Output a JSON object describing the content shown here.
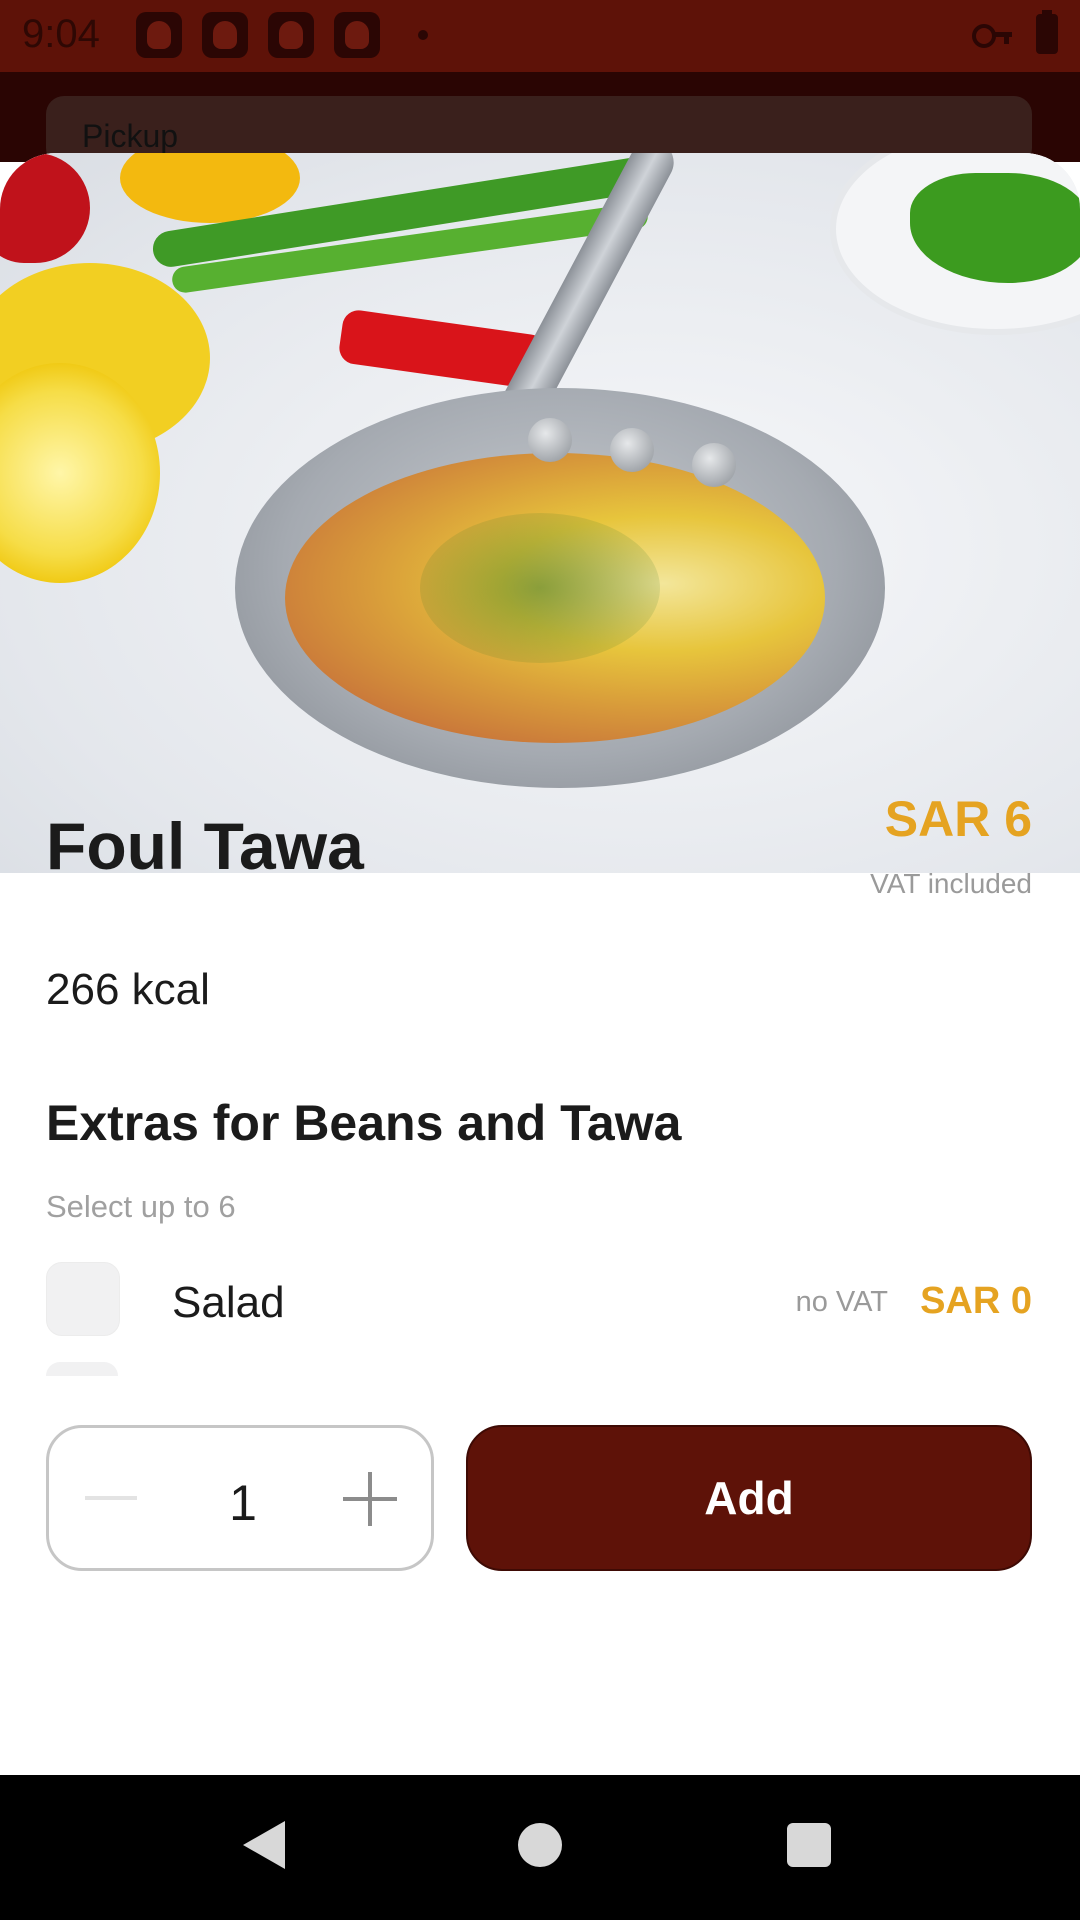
{
  "status_bar": {
    "time": "9:04",
    "app_icons": [
      "app-icon",
      "app-icon",
      "app-icon",
      "app-icon"
    ],
    "icons": [
      "vpn-key-icon",
      "battery-charging-icon"
    ]
  },
  "background": {
    "order_type": "Pickup"
  },
  "item": {
    "title": "Foul Tawa",
    "price": "SAR 6",
    "vat_note": "VAT included",
    "calories": "266 kcal"
  },
  "extras": {
    "title": "Extras for Beans and Tawa",
    "hint": "Select up to 6",
    "options": [
      {
        "label": "Salad",
        "vat": "no VAT",
        "price": "SAR 0",
        "checked": false
      }
    ]
  },
  "footer": {
    "quantity": "1",
    "add_label": "Add"
  },
  "colors": {
    "brand": "#5e1208",
    "accent": "#e5a321",
    "muted": "#9a9a9a"
  }
}
